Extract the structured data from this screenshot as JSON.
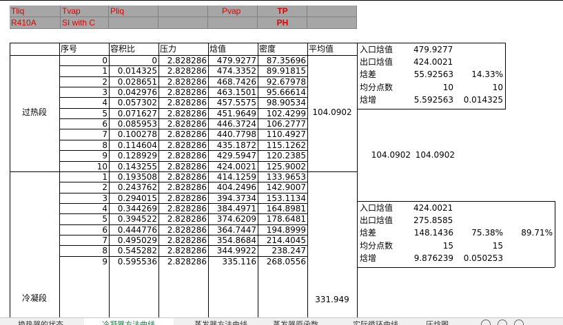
{
  "params": {
    "r1": [
      "Tliq",
      "Tvap",
      "Pliq",
      "",
      "Pvap",
      "TP"
    ],
    "r2": [
      "R410A",
      "SI with C",
      "",
      "",
      "",
      "PH"
    ]
  },
  "headers": [
    "序号",
    "容积比",
    "压力",
    "焓值",
    "密度",
    "平均值"
  ],
  "sections": {
    "superheat": {
      "label": "过热段",
      "avg": "104.0902",
      "rows": [
        [
          "0",
          "0",
          "2.828286",
          "479.9277",
          "87.35696"
        ],
        [
          "1",
          "0.014325",
          "2.828286",
          "474.3352",
          "89.91815"
        ],
        [
          "2",
          "0.028651",
          "2.828286",
          "468.7426",
          "92.67978"
        ],
        [
          "3",
          "0.042976",
          "2.828286",
          "463.1501",
          "95.66614"
        ],
        [
          "4",
          "0.057302",
          "2.828286",
          "457.5575",
          "98.90534"
        ],
        [
          "5",
          "0.071627",
          "2.828286",
          "451.9649",
          "102.4299"
        ],
        [
          "6",
          "0.085953",
          "2.828286",
          "446.3724",
          "106.2777"
        ],
        [
          "7",
          "0.100278",
          "2.828286",
          "440.7798",
          "110.4927"
        ],
        [
          "8",
          "0.114604",
          "2.828286",
          "435.1872",
          "115.1262"
        ],
        [
          "9",
          "0.128929",
          "2.828286",
          "429.5947",
          "120.2385"
        ],
        [
          "10",
          "0.143255",
          "2.828286",
          "424.0021",
          "125.9002"
        ]
      ]
    },
    "condense": {
      "label": "冷凝段",
      "avg": "331.949",
      "rows": [
        [
          "1",
          "0.193508",
          "2.828286",
          "414.1259",
          "133.9653"
        ],
        [
          "2",
          "0.243762",
          "2.828286",
          "404.2496",
          "142.9007"
        ],
        [
          "3",
          "0.294015",
          "2.828286",
          "394.3734",
          "153.1134"
        ],
        [
          "4",
          "0.344269",
          "2.828286",
          "384.4971",
          "164.8981"
        ],
        [
          "5",
          "0.394522",
          "2.828286",
          "374.6209",
          "178.6481"
        ],
        [
          "6",
          "0.444776",
          "2.828286",
          "364.7447",
          "194.8999"
        ],
        [
          "7",
          "0.495029",
          "2.828286",
          "354.8684",
          "214.4045"
        ],
        [
          "8",
          "0.545282",
          "2.828286",
          "344.9922",
          "238.247"
        ],
        [
          "9",
          "0.595536",
          "2.828286",
          "335.116",
          "268.0556"
        ]
      ]
    }
  },
  "summary1": {
    "rows": [
      [
        "入口焓值",
        "479.9277",
        ""
      ],
      [
        "出口焓值",
        "424.0021",
        ""
      ],
      [
        "焓差",
        "55.92563",
        "14.33%"
      ],
      [
        "均分点数",
        "10",
        "10"
      ],
      [
        "焓增",
        "5.592563",
        "0.014325"
      ]
    ],
    "avg_a": "104.0902",
    "avg_b": "104.0902"
  },
  "summary2": {
    "rows": [
      [
        "入口焓值",
        "424.0021",
        ""
      ],
      [
        "出口焓值",
        "275.8585",
        ""
      ],
      [
        "焓差",
        "148.1436",
        "75.38%"
      ],
      [
        "均分点数",
        "15",
        "15"
      ],
      [
        "焓增",
        "9.876239",
        "0.050253"
      ]
    ],
    "extra": "89.71%"
  },
  "tabs": [
    "换热器的状态",
    "冷凝器方法曲线",
    "蒸发器方法曲线",
    "蒸发器原函数",
    "实际循环曲线",
    "压焓图"
  ],
  "active_tab": 1
}
